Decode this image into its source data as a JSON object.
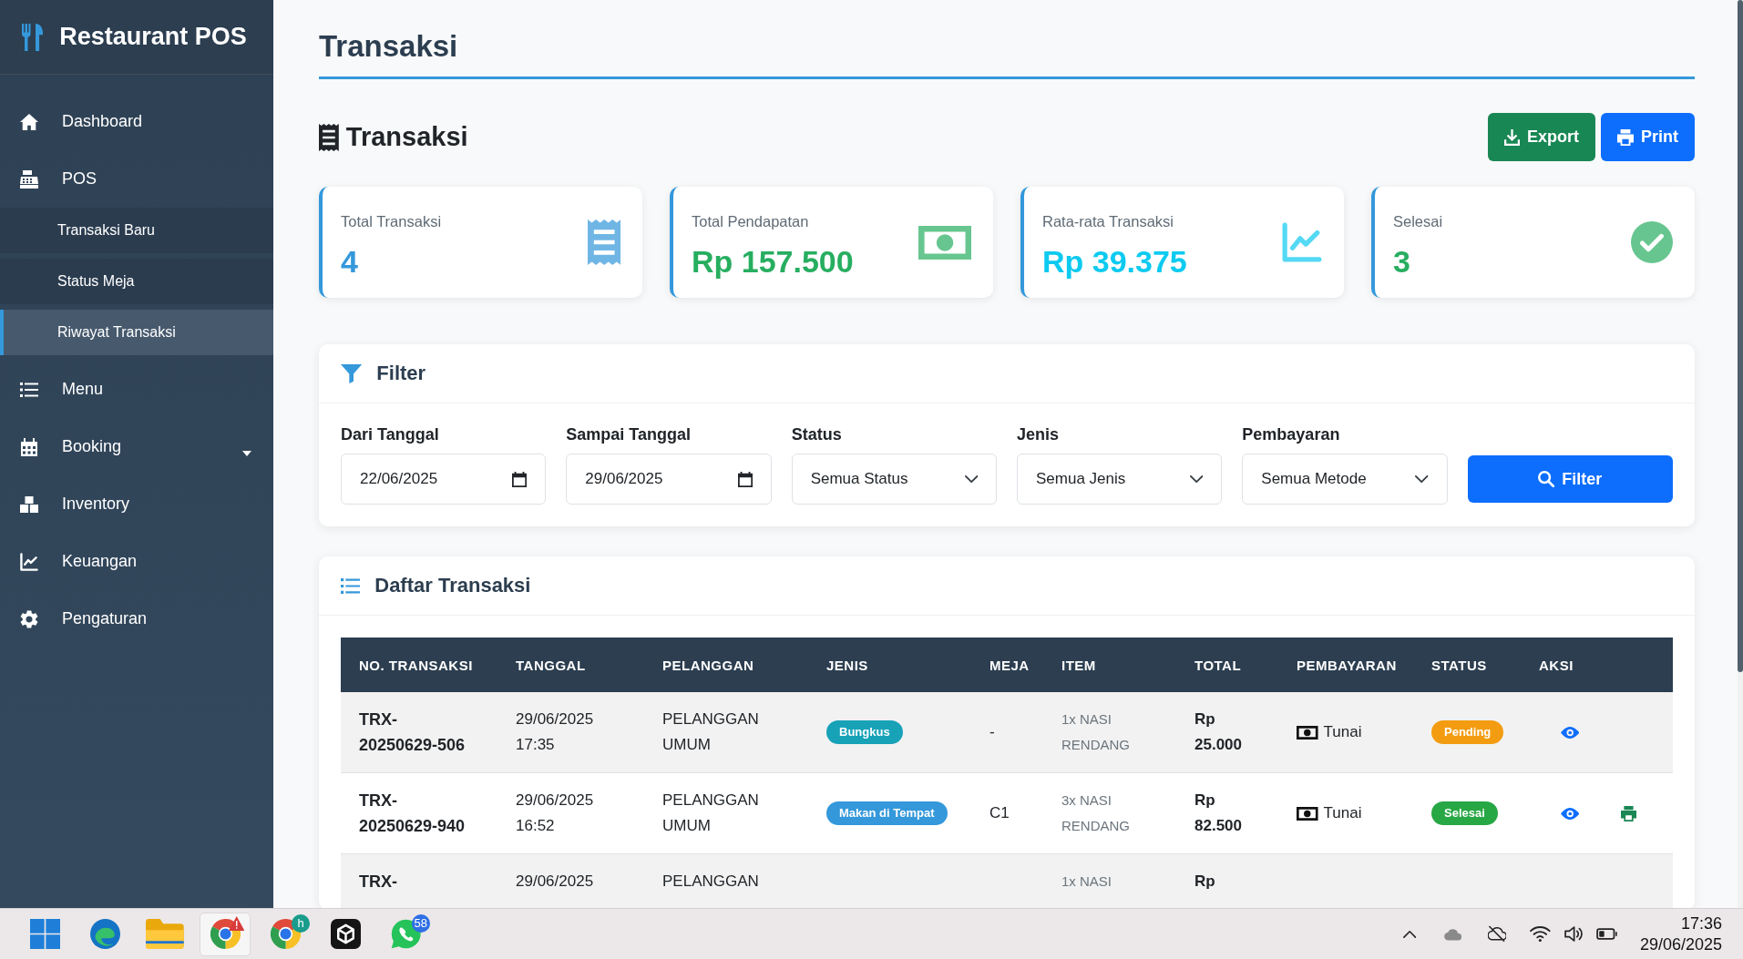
{
  "sidebar": {
    "brand": "Restaurant POS",
    "items": [
      {
        "label": "Dashboard",
        "selected": false
      },
      {
        "label": "POS",
        "selected": false,
        "expanded": true,
        "children": [
          {
            "label": "Transaksi Baru",
            "selected": false
          },
          {
            "label": "Status Meja",
            "selected": false
          },
          {
            "label": "Riwayat Transaksi",
            "selected": true
          }
        ]
      },
      {
        "label": "Menu",
        "selected": false
      },
      {
        "label": "Booking",
        "selected": false,
        "expanded": false
      },
      {
        "label": "Inventory",
        "selected": false
      },
      {
        "label": "Keuangan",
        "selected": false
      },
      {
        "label": "Pengaturan",
        "selected": false
      }
    ]
  },
  "page_title": "Transaksi",
  "section": {
    "title": "Transaksi",
    "buttons": [
      {
        "label": "Export",
        "kind": "export"
      },
      {
        "label": "Print",
        "kind": "print"
      }
    ]
  },
  "stats": [
    {
      "label": "Total Transaksi",
      "value": "4",
      "color": "#3498db"
    },
    {
      "label": "Total Pendapatan",
      "value": "Rp 157.500",
      "color": "#27ae60"
    },
    {
      "label": "Rata-rata Transaksi",
      "value": "Rp 39.375",
      "color": "#0dcaf0"
    },
    {
      "label": "Selesai",
      "value": "3",
      "color": "#27ae60"
    }
  ],
  "filter": {
    "title": "Filter",
    "fields": [
      {
        "label": "Dari Tanggal",
        "kind": "date",
        "value": "22/06/2025"
      },
      {
        "label": "Sampai Tanggal",
        "kind": "date",
        "value": "29/06/2025"
      },
      {
        "label": "Status",
        "kind": "select",
        "value": "Semua Status"
      },
      {
        "label": "Jenis",
        "kind": "select",
        "value": "Semua Jenis"
      },
      {
        "label": "Pembayaran",
        "kind": "select",
        "value": "Semua Metode"
      }
    ],
    "button": "Filter"
  },
  "transactions": {
    "title": "Daftar Transaksi",
    "columns": [
      "NO. TRANSAKSI",
      "TANGGAL",
      "PELANGGAN",
      "JENIS",
      "MEJA",
      "ITEM",
      "TOTAL",
      "PEMBAYARAN",
      "STATUS",
      "AKSI"
    ],
    "rows": [
      {
        "number": "TRX-20250629-506",
        "date": "29/06/2025 17:35",
        "customer": "PELANGGAN UMUM",
        "type": {
          "label": "Bungkus",
          "color": "#17a2b8"
        },
        "table": "-",
        "items": "1x NASI RENDANG",
        "total": "Rp 25.000",
        "payment": "Tunai",
        "status": {
          "label": "Pending",
          "color": "#f39c12"
        },
        "actions": [
          {
            "kind": "view"
          }
        ]
      },
      {
        "number": "TRX-20250629-940",
        "date": "29/06/2025 16:52",
        "customer": "PELANGGAN UMUM",
        "type": {
          "label": "Makan di Tempat",
          "color": "#3498db"
        },
        "table": "C1",
        "items": "3x NASI RENDANG",
        "total": "Rp 82.500",
        "payment": "Tunai",
        "status": {
          "label": "Selesai",
          "color": "#28a745"
        },
        "actions": [
          {
            "kind": "view"
          },
          {
            "kind": "print"
          }
        ]
      },
      {
        "number": "TRX-",
        "date": "29/06/2025",
        "customer": "PELANGGAN",
        "items": "1x NASI",
        "total": "Rp"
      }
    ]
  },
  "taskbar": {
    "apps": [
      {
        "selected": false,
        "alert": false
      },
      {
        "selected": false,
        "alert": false
      },
      {
        "selected": false,
        "alert": false
      },
      {
        "selected": true,
        "alert": true
      },
      {
        "selected": false,
        "alert": false,
        "badge": {
          "text": "h",
          "color": "#1a9c8c"
        }
      },
      {
        "selected": false,
        "alert": false
      },
      {
        "selected": false,
        "alert": false,
        "badge": {
          "text": "58",
          "color": "#2f6fe4"
        }
      }
    ],
    "time": "17:36",
    "date": "29/06/2025"
  }
}
